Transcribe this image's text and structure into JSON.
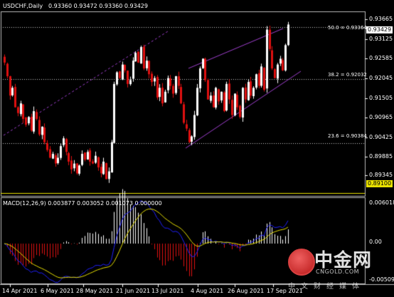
{
  "header": {
    "symbol": "USDCHF,Daily",
    "ohlc": "0.93360 0.93472 0.93360 0.93429"
  },
  "price_axis": {
    "ticks": [
      "0.93665",
      "0.93125",
      "0.92585",
      "0.92045",
      "0.91505",
      "0.90965",
      "0.90425",
      "0.89885",
      "0.89345"
    ],
    "current_price": "0.93429",
    "support_price": "0.89100"
  },
  "fib_levels": [
    {
      "label": "50.0 = 0.93364",
      "value": 0.93364
    },
    {
      "label": "38.2 = 0.92032",
      "value": 0.92032
    },
    {
      "label": "23.6 = 0.90384",
      "value": 0.90384
    }
  ],
  "macd": {
    "label": "MACD(12,26,9) 0.003877 0.003052 0.001073 0.000000",
    "ticks": [
      "0.006018",
      "0.00",
      "-0.005092"
    ]
  },
  "date_axis": [
    "14 Apr 2021",
    "6 May 2021",
    "28 May 2021",
    "21 Jun 2021",
    "13 Jul 2021",
    "4 Aug 2021",
    "26 Aug 2021",
    "17 Sep 2021"
  ],
  "watermark": {
    "brand": "中金网",
    "url": "CNGOLD.COM",
    "tagline": "中文财经媒体"
  },
  "colors": {
    "background": "#000000",
    "bull_candle": "#ffffff",
    "bear_candle": "#e01010",
    "channel": "#a040d0",
    "signal_line": "#e8e000",
    "macd_line": "#2020ff",
    "support_line": "#e8e000"
  },
  "chart_data": {
    "type": "candlestick",
    "close_series": [
      0.9245,
      0.921,
      0.916,
      0.918,
      0.913,
      0.9115,
      0.914,
      0.91,
      0.9085,
      0.9105,
      0.907,
      0.912,
      0.91,
      0.906,
      0.908,
      0.904,
      0.902,
      0.9,
      0.901,
      0.8985,
      0.9,
      0.903,
      0.905,
      0.9015,
      0.899,
      0.897,
      0.8985,
      0.896,
      0.898,
      0.901,
      0.8995,
      0.9015,
      0.899,
      0.8985,
      0.9005,
      0.8975,
      0.896,
      0.899,
      0.8945,
      0.8965,
      0.904,
      0.919,
      0.922,
      0.9205,
      0.924,
      0.9225,
      0.919,
      0.92,
      0.925,
      0.927,
      0.9245,
      0.9285,
      0.923,
      0.925,
      0.9215,
      0.9195,
      0.9205,
      0.9155,
      0.918,
      0.914,
      0.917,
      0.9205,
      0.9185,
      0.9165,
      0.921,
      0.9185,
      0.914,
      0.909,
      0.9075,
      0.904,
      0.9055,
      0.911,
      0.918,
      0.923,
      0.9255,
      0.92,
      0.915,
      0.916,
      0.913,
      0.918,
      0.9145,
      0.917,
      0.912,
      0.919,
      0.915,
      0.911,
      0.9165,
      0.913,
      0.9105,
      0.918,
      0.915,
      0.9195,
      0.916,
      0.918,
      0.9215,
      0.9185,
      0.9235,
      0.9175,
      0.933,
      0.928,
      0.923,
      0.9205,
      0.924,
      0.9255,
      0.9225,
      0.929,
      0.9343
    ],
    "price_range": [
      0.89,
      0.9375
    ],
    "macd_range": [
      -0.005092,
      0.006018
    ]
  }
}
